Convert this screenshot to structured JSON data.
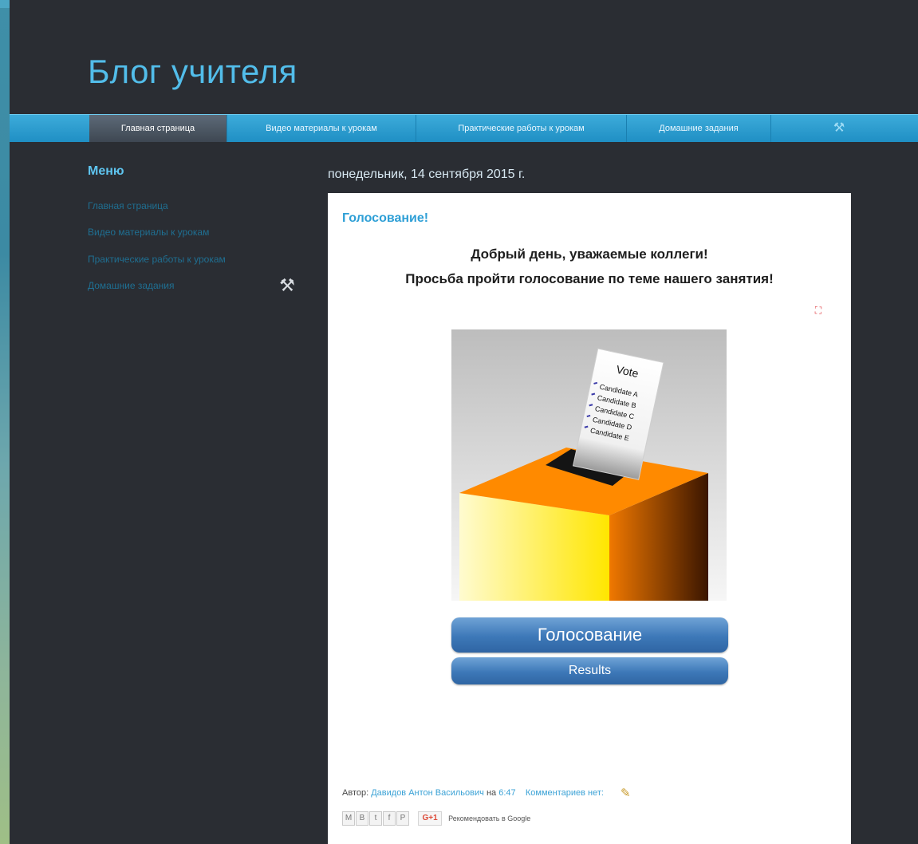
{
  "blog": {
    "title": "Блог учителя"
  },
  "nav": {
    "tabs": [
      {
        "label": "Главная страница",
        "active": true
      },
      {
        "label": "Видео материалы к урокам",
        "active": false
      },
      {
        "label": "Практические работы к урокам",
        "active": false
      },
      {
        "label": "Домашние задания",
        "active": false
      }
    ],
    "tools_icon": "wrench-screwdriver-icon"
  },
  "sidebar": {
    "title": "Меню",
    "items": [
      {
        "label": "Главная страница"
      },
      {
        "label": "Видео материалы к урокам"
      },
      {
        "label": "Практические работы к урокам"
      },
      {
        "label": "Домашние задания"
      }
    ],
    "tools_icon": "wrench-screwdriver-icon"
  },
  "main": {
    "date": "понедельник, 14 сентября 2015 г.",
    "post": {
      "title": "Голосование!",
      "line1": "Добрый день, уважаемые коллеги!",
      "line2": "Просьба пройти голосование по теме нашего занятия!",
      "image": {
        "ballot_title": "Vote",
        "candidates": [
          "Candidate A",
          "Candidate B",
          "Candidate C",
          "Candidate D",
          "Candidate E"
        ]
      },
      "vote_button": "Голосование",
      "results_button": "Results",
      "footer": {
        "author_prefix": "Автор:",
        "author": "Давидов Антон Васильович",
        "at": "на",
        "time": "6:47",
        "comments": "Комментариев нет:"
      },
      "share": {
        "buttons": [
          "M",
          "B",
          "t",
          "f",
          "P"
        ],
        "gplus": "G+1",
        "gplus_text": "Рекомендовать в Google"
      }
    }
  },
  "colors": {
    "page_bg": "#2a2d33",
    "accent": "#52bdea",
    "navbar": "#1f8fc4",
    "button": "#3d78b8",
    "box_orange": "#ff8a00",
    "box_yellow": "#ffe600"
  }
}
